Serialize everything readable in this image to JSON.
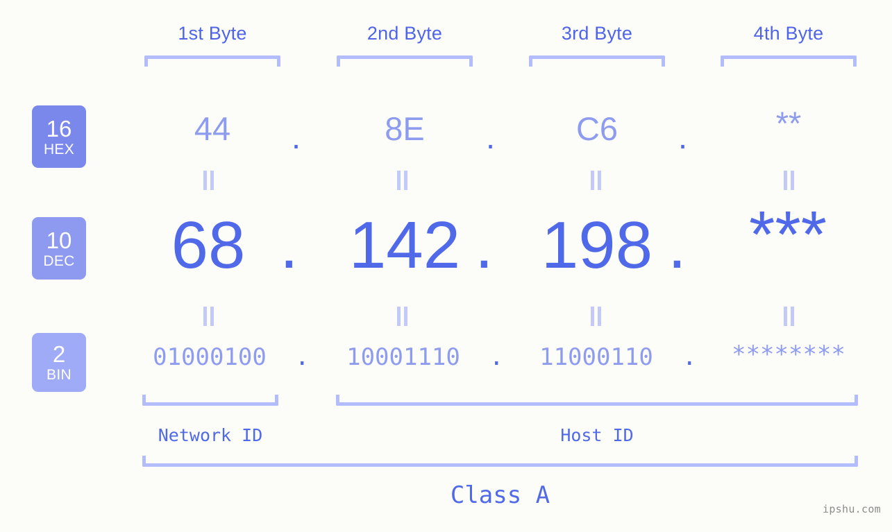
{
  "background_color": "#fcfdf9",
  "accent_color": "#5069e8",
  "accent_light": "#8e9cf0",
  "bracket_color": "#b4bdfb",
  "headers": [
    {
      "label": "1st Byte"
    },
    {
      "label": "2nd Byte"
    },
    {
      "label": "3rd Byte"
    },
    {
      "label": "4th Byte"
    }
  ],
  "bases": [
    {
      "number": "16",
      "name": "HEX",
      "color": "#7a88ec"
    },
    {
      "number": "10",
      "name": "DEC",
      "color": "#8e9aef"
    },
    {
      "number": "2",
      "name": "BIN",
      "color": "#9fabf6"
    }
  ],
  "rows": {
    "hex": {
      "values": [
        "44",
        "8E",
        "C6",
        "**"
      ],
      "separator": "."
    },
    "dec": {
      "values": [
        "68",
        "142",
        "198",
        "***"
      ],
      "separator": "."
    },
    "bin": {
      "values": [
        "01000100",
        "10001110",
        "11000110",
        "********"
      ],
      "separator": "."
    }
  },
  "equals_symbol": "=",
  "segments": {
    "network_id": "Network ID",
    "host_id": "Host ID"
  },
  "class_label": "Class A",
  "watermark": "ipshu.com"
}
